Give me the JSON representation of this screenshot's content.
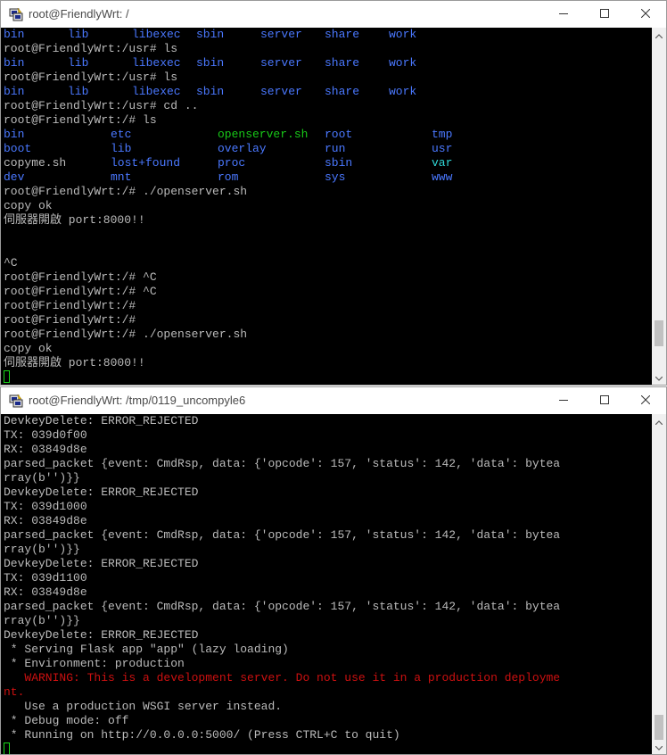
{
  "window1": {
    "title": "root@FriendlyWrt: /",
    "scroll_position": 0.92,
    "lines": [
      {
        "cols": [
          {
            "t": "bin",
            "c": "blue",
            "w": 72
          },
          {
            "t": "lib",
            "c": "blue",
            "w": 72
          },
          {
            "t": "libexec",
            "c": "blue",
            "w": 72
          },
          {
            "t": "sbin",
            "c": "blue",
            "w": 72
          },
          {
            "t": "server",
            "c": "blue",
            "w": 72
          },
          {
            "t": "share",
            "c": "blue",
            "w": 72
          },
          {
            "t": "work",
            "c": "blue",
            "w": 0
          }
        ]
      },
      {
        "text": "root@FriendlyWrt:/usr# ls"
      },
      {
        "cols": [
          {
            "t": "bin",
            "c": "blue",
            "w": 72
          },
          {
            "t": "lib",
            "c": "blue",
            "w": 72
          },
          {
            "t": "libexec",
            "c": "blue",
            "w": 72
          },
          {
            "t": "sbin",
            "c": "blue",
            "w": 72
          },
          {
            "t": "server",
            "c": "blue",
            "w": 72
          },
          {
            "t": "share",
            "c": "blue",
            "w": 72
          },
          {
            "t": "work",
            "c": "blue",
            "w": 0
          }
        ]
      },
      {
        "text": "root@FriendlyWrt:/usr# ls"
      },
      {
        "cols": [
          {
            "t": "bin",
            "c": "blue",
            "w": 72
          },
          {
            "t": "lib",
            "c": "blue",
            "w": 72
          },
          {
            "t": "libexec",
            "c": "blue",
            "w": 72
          },
          {
            "t": "sbin",
            "c": "blue",
            "w": 72
          },
          {
            "t": "server",
            "c": "blue",
            "w": 72
          },
          {
            "t": "share",
            "c": "blue",
            "w": 72
          },
          {
            "t": "work",
            "c": "blue",
            "w": 0
          }
        ]
      },
      {
        "text": "root@FriendlyWrt:/usr# cd .."
      },
      {
        "text": "root@FriendlyWrt:/# ls"
      },
      {
        "cols": [
          {
            "t": "bin",
            "c": "blue",
            "w": 120
          },
          {
            "t": "etc",
            "c": "blue",
            "w": 120
          },
          {
            "t": "openserver.sh",
            "c": "green",
            "w": 120
          },
          {
            "t": "root",
            "c": "blue",
            "w": 120
          },
          {
            "t": "tmp",
            "c": "blue",
            "w": 0
          }
        ]
      },
      {
        "cols": [
          {
            "t": "boot",
            "c": "blue",
            "w": 120
          },
          {
            "t": "lib",
            "c": "blue",
            "w": 120
          },
          {
            "t": "overlay",
            "c": "blue",
            "w": 120
          },
          {
            "t": "run",
            "c": "blue",
            "w": 120
          },
          {
            "t": "usr",
            "c": "blue",
            "w": 0
          }
        ]
      },
      {
        "cols": [
          {
            "t": "copyme.sh",
            "c": "",
            "w": 120
          },
          {
            "t": "lost+found",
            "c": "blue",
            "w": 120
          },
          {
            "t": "proc",
            "c": "blue",
            "w": 120
          },
          {
            "t": "sbin",
            "c": "blue",
            "w": 120
          },
          {
            "t": "var",
            "c": "cyan",
            "w": 0
          }
        ]
      },
      {
        "cols": [
          {
            "t": "dev",
            "c": "blue",
            "w": 120
          },
          {
            "t": "mnt",
            "c": "blue",
            "w": 120
          },
          {
            "t": "rom",
            "c": "blue",
            "w": 120
          },
          {
            "t": "sys",
            "c": "blue",
            "w": 120
          },
          {
            "t": "www",
            "c": "blue",
            "w": 0
          }
        ]
      },
      {
        "text": "root@FriendlyWrt:/# ./openserver.sh"
      },
      {
        "text": "copy ok"
      },
      {
        "text": "伺服器開啟 port:8000!!"
      },
      {
        "text": ""
      },
      {
        "text": ""
      },
      {
        "text": "^C"
      },
      {
        "text": "root@FriendlyWrt:/# ^C"
      },
      {
        "text": "root@FriendlyWrt:/# ^C"
      },
      {
        "text": "root@FriendlyWrt:/#"
      },
      {
        "text": "root@FriendlyWrt:/#"
      },
      {
        "text": "root@FriendlyWrt:/# ./openserver.sh"
      },
      {
        "text": "copy ok"
      },
      {
        "text": "伺服器開啟 port:8000!!"
      },
      {
        "text": "",
        "cursor": true
      }
    ]
  },
  "window2": {
    "title": "root@FriendlyWrt: /tmp/0119_uncompyle6",
    "scroll_position": 1.0,
    "lines": [
      {
        "text": "DevkeyDelete: ERROR_REJECTED"
      },
      {
        "text": "TX: 039d0f00"
      },
      {
        "text": "RX: 03849d8e"
      },
      {
        "text": "parsed_packet {event: CmdRsp, data: {'opcode': 157, 'status': 142, 'data': bytea"
      },
      {
        "text": "rray(b'')}}"
      },
      {
        "text": "DevkeyDelete: ERROR_REJECTED"
      },
      {
        "text": "TX: 039d1000"
      },
      {
        "text": "RX: 03849d8e"
      },
      {
        "text": "parsed_packet {event: CmdRsp, data: {'opcode': 157, 'status': 142, 'data': bytea"
      },
      {
        "text": "rray(b'')}}"
      },
      {
        "text": "DevkeyDelete: ERROR_REJECTED"
      },
      {
        "text": "TX: 039d1100"
      },
      {
        "text": "RX: 03849d8e"
      },
      {
        "text": "parsed_packet {event: CmdRsp, data: {'opcode': 157, 'status': 142, 'data': bytea"
      },
      {
        "text": "rray(b'')}}"
      },
      {
        "text": "DevkeyDelete: ERROR_REJECTED"
      },
      {
        "text": " * Serving Flask app \"app\" (lazy loading)"
      },
      {
        "text": " * Environment: production"
      },
      {
        "text": "   WARNING: This is a development server. Do not use it in a production deployme",
        "c": "red"
      },
      {
        "text": "nt.",
        "c": "red"
      },
      {
        "text": "   Use a production WSGI server instead."
      },
      {
        "text": " * Debug mode: off"
      },
      {
        "text": " * Running on http://0.0.0.0:5000/ (Press CTRL+C to quit)"
      },
      {
        "text": "",
        "cursor": true
      }
    ]
  },
  "icons": {
    "app": "putty-icon",
    "minimize": "minimize-icon",
    "maximize": "maximize-icon",
    "close": "close-icon"
  },
  "colors": {
    "term_bg": "#000000",
    "term_fg": "#bbbbbb",
    "dir_blue": "#4a78ff",
    "exec_green": "#18c818",
    "link_cyan": "#30d8d8",
    "warning_red": "#cc1010"
  }
}
